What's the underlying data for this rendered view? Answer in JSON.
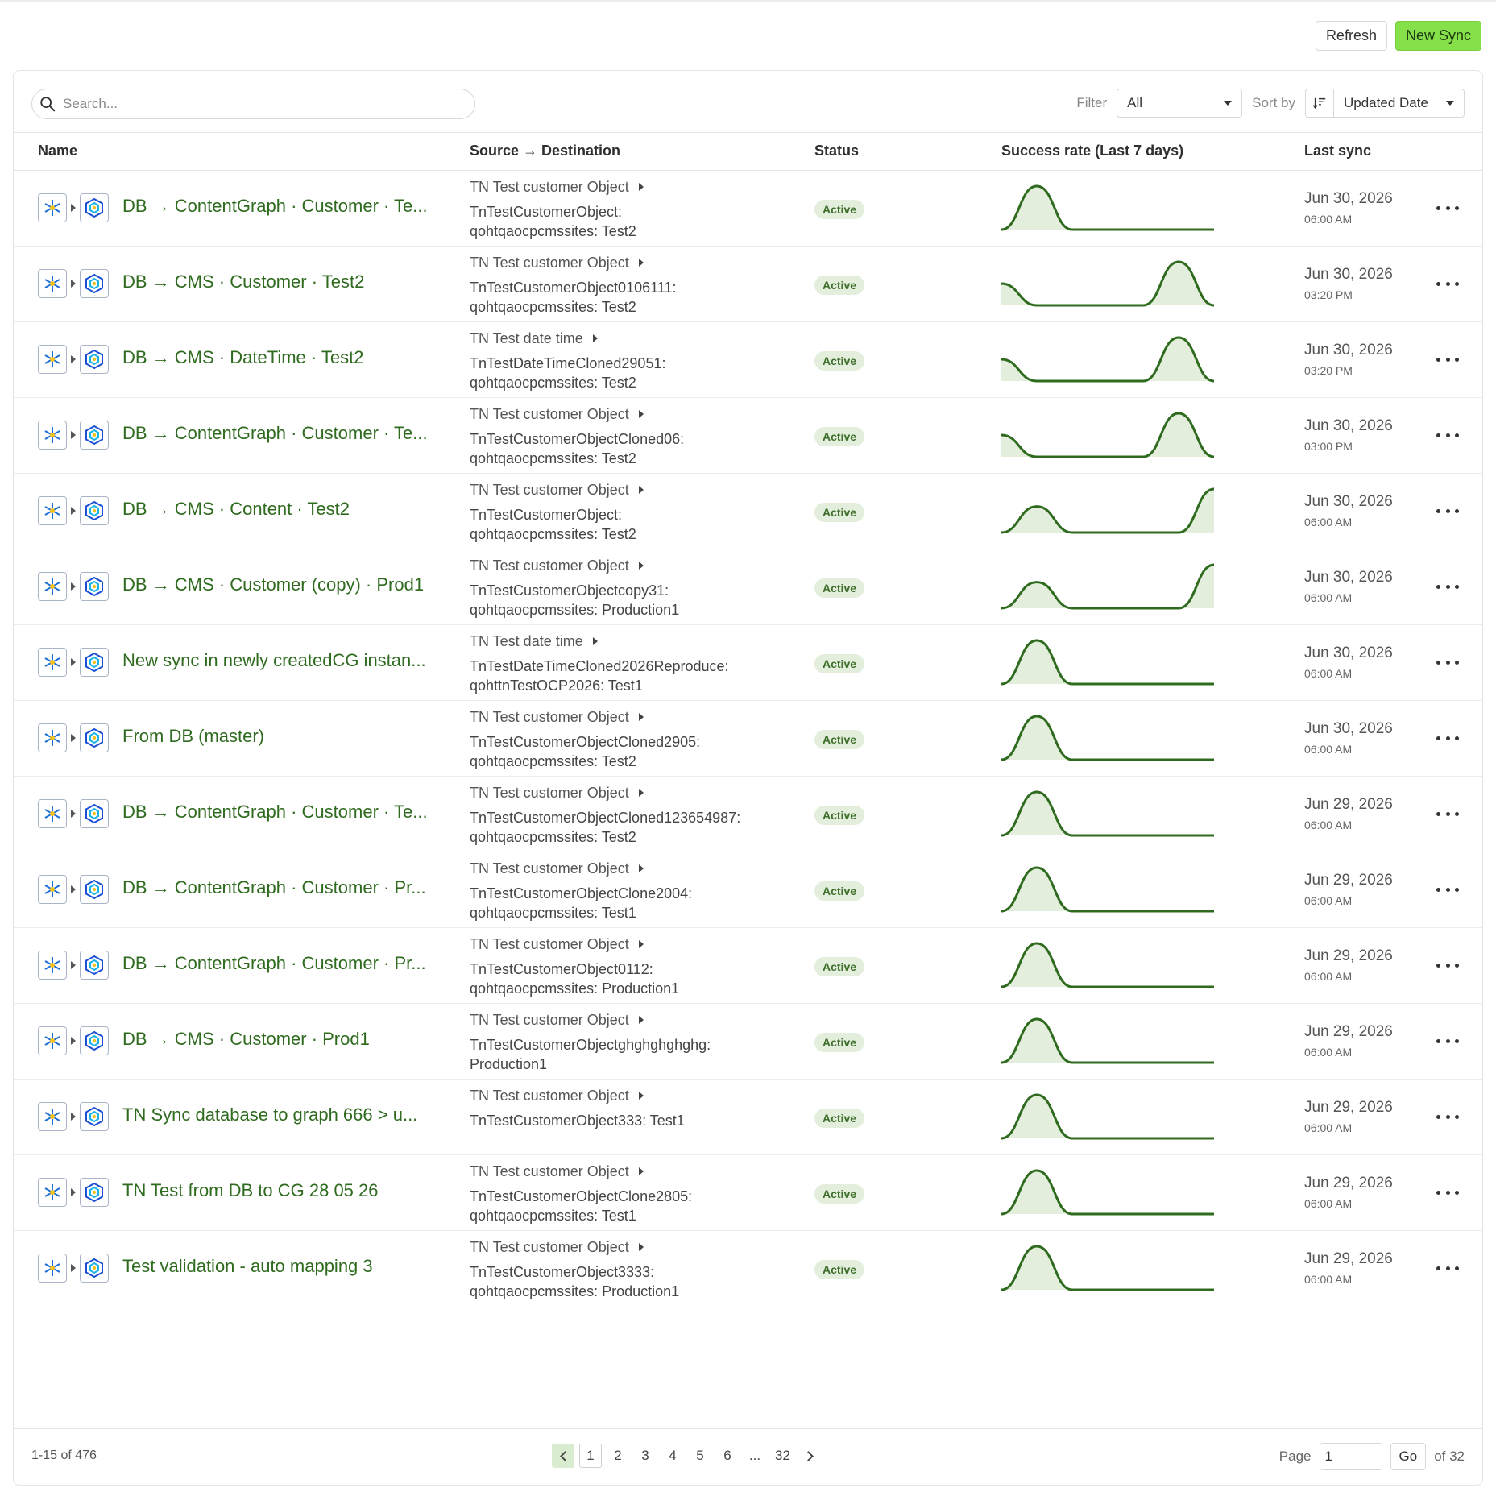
{
  "toolbar": {
    "refresh_label": "Refresh",
    "new_sync_label": "New Sync"
  },
  "search": {
    "placeholder": "Search..."
  },
  "filter": {
    "label": "Filter",
    "value": "All"
  },
  "sort": {
    "label": "Sort by",
    "value": "Updated Date"
  },
  "columns": {
    "name": "Name",
    "source_destination": "Source → Destination",
    "status": "Status",
    "success_rate": "Success rate (Last 7 days)",
    "last_sync": "Last sync"
  },
  "colors": {
    "accent_green": "#2f6b1f",
    "primary_button": "#86e04a",
    "spark_line": "#2f6b1f",
    "spark_fill": "#e3efdc"
  },
  "rows": [
    {
      "name": "DB → ContentGraph · Customer · Te...",
      "source": "TN Test customer Object",
      "dest_line1": "TnTestCustomerObject:",
      "dest_line2": "qohtqaocpcmssites: Test2",
      "status": "Active",
      "date": "Jun 30, 2026",
      "time": "06:00 AM",
      "trend": [
        0,
        1,
        0,
        0,
        0,
        0,
        0
      ]
    },
    {
      "name": "DB → CMS · Customer · Test2",
      "source": "TN Test customer Object",
      "dest_line1": "TnTestCustomerObject0106111:",
      "dest_line2": "qohtqaocpcmssites: Test2",
      "status": "Active",
      "date": "Jun 30, 2026",
      "time": "03:20 PM",
      "trend": [
        0.5,
        0,
        0,
        0,
        0,
        1,
        0
      ]
    },
    {
      "name": "DB → CMS · DateTime · Test2",
      "source": "TN Test date time",
      "dest_line1": "TnTestDateTimeCloned29051:",
      "dest_line2": "qohtqaocpcmssites: Test2",
      "status": "Active",
      "date": "Jun 30, 2026",
      "time": "03:20 PM",
      "trend": [
        0.5,
        0,
        0,
        0,
        0,
        1,
        0
      ]
    },
    {
      "name": "DB → ContentGraph · Customer · Te...",
      "source": "TN Test customer Object",
      "dest_line1": "TnTestCustomerObjectCloned06:",
      "dest_line2": "qohtqaocpcmssites: Test2",
      "status": "Active",
      "date": "Jun 30, 2026",
      "time": "03:00 PM",
      "trend": [
        0.5,
        0,
        0,
        0,
        0,
        1,
        0
      ]
    },
    {
      "name": "DB → CMS · Content · Test2",
      "source": "TN Test customer Object",
      "dest_line1": "TnTestCustomerObject:",
      "dest_line2": "qohtqaocpcmssites: Test2",
      "status": "Active",
      "date": "Jun 30, 2026",
      "time": "06:00 AM",
      "trend": [
        0,
        0.6,
        0,
        0,
        0,
        0,
        1
      ]
    },
    {
      "name": "DB → CMS · Customer (copy) · Prod1",
      "source": "TN Test customer Object",
      "dest_line1": "TnTestCustomerObjectcopy31:",
      "dest_line2": "qohtqaocpcmssites: Production1",
      "status": "Active",
      "date": "Jun 30, 2026",
      "time": "06:00 AM",
      "trend": [
        0,
        0.6,
        0,
        0,
        0,
        0,
        1
      ]
    },
    {
      "name": "New sync in newly createdCG instan...",
      "source": "TN Test date time",
      "dest_line1": "TnTestDateTimeCloned2026Reproduce:",
      "dest_line2": "qohttnTestOCP2026: Test1",
      "status": "Active",
      "date": "Jun 30, 2026",
      "time": "06:00 AM",
      "trend": [
        0,
        1,
        0,
        0,
        0,
        0,
        0
      ]
    },
    {
      "name": "From DB (master)",
      "source": "TN Test customer Object",
      "dest_line1": "TnTestCustomerObjectCloned2905:",
      "dest_line2": "qohtqaocpcmssites: Test2",
      "status": "Active",
      "date": "Jun 30, 2026",
      "time": "06:00 AM",
      "trend": [
        0,
        1,
        0,
        0,
        0,
        0,
        0
      ]
    },
    {
      "name": "DB → ContentGraph · Customer · Te...",
      "source": "TN Test customer Object",
      "dest_line1": "TnTestCustomerObjectCloned123654987:",
      "dest_line2": "qohtqaocpcmssites: Test2",
      "status": "Active",
      "date": "Jun 29, 2026",
      "time": "06:00 AM",
      "trend": [
        0,
        1,
        0,
        0,
        0,
        0,
        0
      ]
    },
    {
      "name": "DB → ContentGraph · Customer · Pr...",
      "source": "TN Test customer Object",
      "dest_line1": "TnTestCustomerObjectClone2004:",
      "dest_line2": "qohtqaocpcmssites: Test1",
      "status": "Active",
      "date": "Jun 29, 2026",
      "time": "06:00 AM",
      "trend": [
        0,
        1,
        0,
        0,
        0,
        0,
        0
      ]
    },
    {
      "name": "DB → ContentGraph · Customer · Pr...",
      "source": "TN Test customer Object",
      "dest_line1": "TnTestCustomerObject0112:",
      "dest_line2": "qohtqaocpcmssites: Production1",
      "status": "Active",
      "date": "Jun 29, 2026",
      "time": "06:00 AM",
      "trend": [
        0,
        1,
        0,
        0,
        0,
        0,
        0
      ]
    },
    {
      "name": "DB → CMS · Customer · Prod1",
      "source": "TN Test customer Object",
      "dest_line1": "TnTestCustomerObjectghghghghghg:",
      "dest_line2": "Production1",
      "status": "Active",
      "date": "Jun 29, 2026",
      "time": "06:00 AM",
      "trend": [
        0,
        1,
        0,
        0,
        0,
        0,
        0
      ]
    },
    {
      "name": "TN Sync database to graph 666 > u...",
      "source": "TN Test customer Object",
      "dest_line1": "TnTestCustomerObject333: Test1",
      "dest_line2": "",
      "status": "Active",
      "date": "Jun 29, 2026",
      "time": "06:00 AM",
      "trend": [
        0,
        1,
        0,
        0,
        0,
        0,
        0
      ]
    },
    {
      "name": "TN Test from DB to CG 28 05 26",
      "source": "TN Test customer Object",
      "dest_line1": "TnTestCustomerObjectClone2805:",
      "dest_line2": "qohtqaocpcmssites: Test1",
      "status": "Active",
      "date": "Jun 29, 2026",
      "time": "06:00 AM",
      "trend": [
        0,
        1,
        0,
        0,
        0,
        0,
        0
      ]
    },
    {
      "name": "Test validation - auto mapping 3",
      "source": "TN Test customer Object",
      "dest_line1": "TnTestCustomerObject3333:",
      "dest_line2": "qohtqaocpcmssites: Production1",
      "status": "Active",
      "date": "Jun 29, 2026",
      "time": "06:00 AM",
      "trend": [
        0,
        1,
        0,
        0,
        0,
        0,
        0
      ]
    }
  ],
  "footer": {
    "range_text": "1-15 of 476",
    "pages": [
      "1",
      "2",
      "3",
      "4",
      "5",
      "6",
      "...",
      "32"
    ],
    "current_page": "1",
    "page_label": "Page",
    "page_input_value": "1",
    "go_label": "Go",
    "of_text": "of 32"
  }
}
